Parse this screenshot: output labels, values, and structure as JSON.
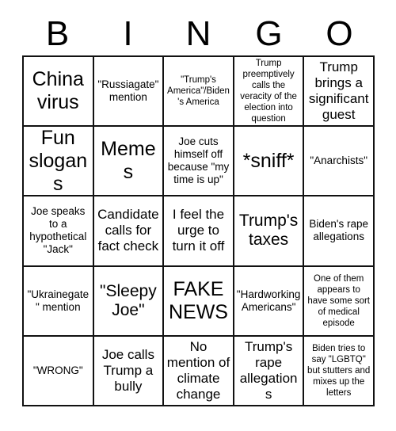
{
  "header": {
    "letters": [
      "B",
      "I",
      "N",
      "G",
      "O"
    ]
  },
  "grid": {
    "rows": 5,
    "columns": 5,
    "border_color": "#111111",
    "background_color": "#ffffff",
    "text_color": "#000000",
    "cells": [
      {
        "text": "China virus",
        "size": "fs-xl"
      },
      {
        "text": "\"Russiagate\" mention",
        "size": "fs-sm"
      },
      {
        "text": "\"Trump's America\"/Biden's America",
        "size": "fs-xs"
      },
      {
        "text": "Trump preemptively calls the veracity of the election into question",
        "size": "fs-xs"
      },
      {
        "text": "Trump brings a significant guest",
        "size": "fs-md"
      },
      {
        "text": "Fun slogans",
        "size": "fs-xl"
      },
      {
        "text": "Memes",
        "size": "fs-xl"
      },
      {
        "text": "Joe cuts himself off because \"my time is up\"",
        "size": "fs-sm"
      },
      {
        "text": "*sniff*",
        "size": "fs-xl"
      },
      {
        "text": "\"Anarchists\"",
        "size": "fs-sm"
      },
      {
        "text": "Joe speaks to a hypothetical \"Jack\"",
        "size": "fs-sm"
      },
      {
        "text": "Candidate calls for fact check",
        "size": "fs-md"
      },
      {
        "text": "I feel the urge to turn it off",
        "size": "fs-md"
      },
      {
        "text": "Trump's taxes",
        "size": "fs-lg"
      },
      {
        "text": "Biden's rape allegations",
        "size": "fs-sm"
      },
      {
        "text": "\"Ukrainegate\" mention",
        "size": "fs-sm"
      },
      {
        "text": "\"Sleepy Joe\"",
        "size": "fs-lg"
      },
      {
        "text": "FAKE NEWS",
        "size": "fs-xl"
      },
      {
        "text": "\"Hardworking Americans\"",
        "size": "fs-sm"
      },
      {
        "text": "One of them appears to have some sort of medical episode",
        "size": "fs-xs"
      },
      {
        "text": "\"WRONG\"",
        "size": "fs-sm"
      },
      {
        "text": "Joe calls Trump a bully",
        "size": "fs-md"
      },
      {
        "text": "No mention of climate change",
        "size": "fs-md"
      },
      {
        "text": "Trump's rape allegations",
        "size": "fs-md"
      },
      {
        "text": "Biden tries to say \"LGBTQ\" but stutters and mixes up the letters",
        "size": "fs-xs"
      }
    ]
  }
}
